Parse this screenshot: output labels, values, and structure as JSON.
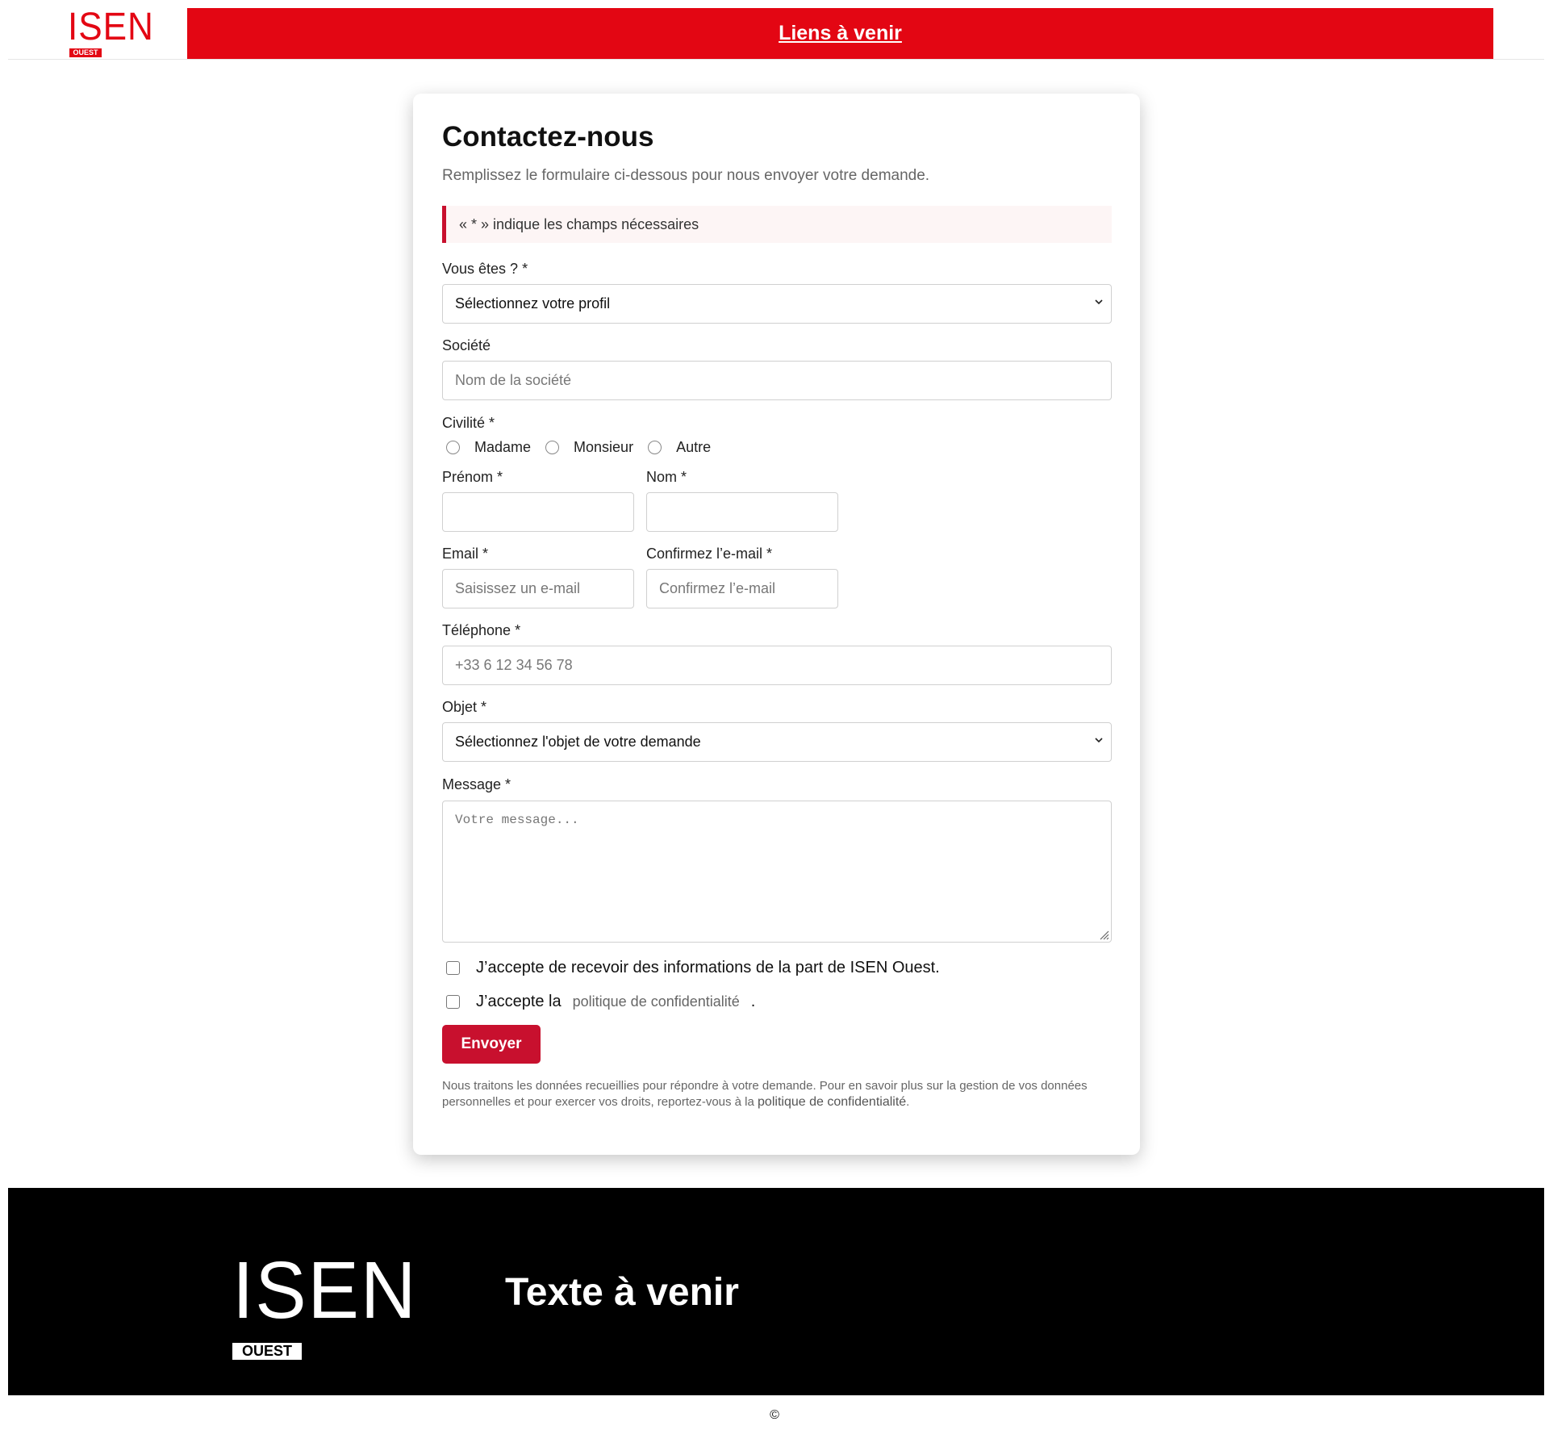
{
  "header": {
    "logo_text": "ISEN",
    "logo_sub": "OUEST",
    "link": "Liens à venir"
  },
  "form": {
    "title": "Contactez-nous",
    "subtitle": "Remplissez le formulaire ci-dessous pour nous envoyer votre demande.",
    "notice": "« * » indique les champs nécessaires",
    "profile": {
      "label": "Vous êtes ? *",
      "value": "Sélectionnez votre profil"
    },
    "company": {
      "label": "Société",
      "placeholder": "Nom de la société"
    },
    "civility": {
      "label": "Civilité *",
      "options": [
        "Madame",
        "Monsieur",
        "Autre"
      ]
    },
    "firstname": {
      "label": "Prénom *",
      "value": ""
    },
    "lastname": {
      "label": "Nom *",
      "value": ""
    },
    "email": {
      "label": "Email *",
      "placeholder": "Saisissez un e-mail"
    },
    "email_confirm": {
      "label": "Confirmez l’e-mail *",
      "placeholder": "Confirmez l’e-mail"
    },
    "phone": {
      "label": "Téléphone *",
      "placeholder": "+33 6 12 34 56 78"
    },
    "subject": {
      "label": "Objet *",
      "value": "Sélectionnez l'objet de votre demande"
    },
    "message": {
      "label": "Message *",
      "placeholder": "Votre message..."
    },
    "consent_info": "J’accepte de recevoir des informations de la part de ISEN Ouest.",
    "consent_policy_prefix": "J’accepte la",
    "consent_policy_link": "politique de confidentialité",
    "consent_policy_suffix": ".",
    "submit": "Envoyer",
    "legal_text": "Nous traitons les données recueillies pour répondre à votre demande. Pour en savoir plus sur la gestion de vos données personnelles et pour exercer vos droits, reportez-vous à la",
    "legal_link": "politique de confidentialité",
    "legal_end": "."
  },
  "footer": {
    "logo_text": "ISEN",
    "logo_sub": "OUEST",
    "text": "Texte à venir",
    "copyright": "©"
  },
  "colors": {
    "brand_red": "#e30613",
    "button_red": "#c8102e",
    "footer_bg": "#000000"
  },
  "icons": [
    "chevron-down-icon",
    "resize-handle-icon"
  ]
}
